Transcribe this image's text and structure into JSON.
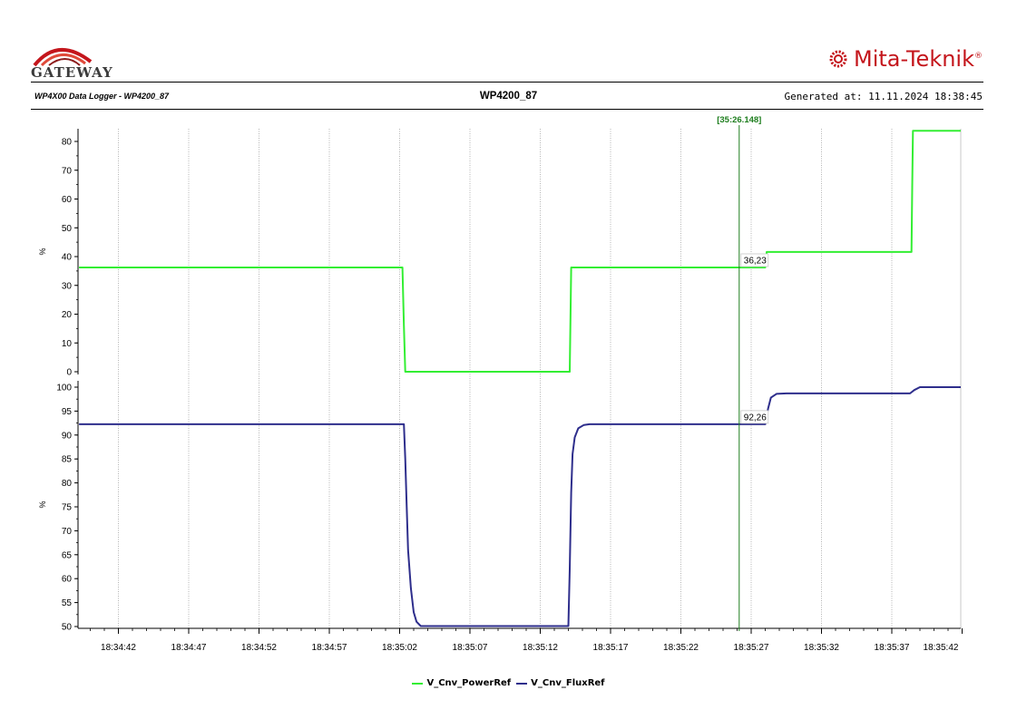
{
  "header": {
    "left_logo": "GATEWAY",
    "right_logo": "Mita-Teknik",
    "right_logo_mark": "®",
    "subtitle_left": "WP4X00 Data Logger - WP4200_87",
    "title": "WP4200_87",
    "generated": "Generated at:  11.11.2024 18:38:45"
  },
  "colors": {
    "power": "#33ee33",
    "flux": "#2e2e8c",
    "cursor": "#1e7e1e",
    "grid": "#a0a0a0"
  },
  "chart_data": {
    "type": "line",
    "cursor": {
      "label": "[35:26.148]",
      "time": "18:35:26.148"
    },
    "x_axis": {
      "ticks": [
        "18:34:42",
        "18:34:47",
        "18:34:52",
        "18:34:57",
        "18:35:02",
        "18:35:07",
        "18:35:12",
        "18:35:17",
        "18:35:22",
        "18:35:27",
        "18:35:32",
        "18:35:37",
        "18:35:42"
      ]
    },
    "panels": [
      {
        "ylabel": "%",
        "ylim": [
          -1,
          84
        ],
        "yticks": [
          0,
          10,
          20,
          30,
          40,
          50,
          60,
          70,
          80
        ],
        "series": [
          {
            "name": "V_Cnv_PowerRef",
            "color": "#33ee33",
            "cursor_value": "36,23",
            "points": [
              [
                -2.8,
                36.23
              ],
              [
                20.2,
                36.23
              ],
              [
                20.3,
                16.0
              ],
              [
                20.4,
                0
              ],
              [
                32.1,
                0
              ],
              [
                32.2,
                36.23
              ],
              [
                46.0,
                36.23
              ],
              [
                46.1,
                41.6
              ],
              [
                56.4,
                41.6
              ],
              [
                56.45,
                64
              ],
              [
                56.5,
                83.7
              ],
              [
                62.0,
                83.7
              ]
            ]
          }
        ]
      },
      {
        "ylabel": "%",
        "ylim": [
          49.5,
          101
        ],
        "yticks": [
          50,
          55,
          60,
          65,
          70,
          75,
          80,
          85,
          90,
          95,
          100
        ],
        "series": [
          {
            "name": "V_Cnv_FluxRef",
            "color": "#2e2e8c",
            "cursor_value": "92,26",
            "points": [
              [
                -2.8,
                92.26
              ],
              [
                20.3,
                92.26
              ],
              [
                20.4,
                85
              ],
              [
                20.5,
                75
              ],
              [
                20.6,
                66
              ],
              [
                20.8,
                58
              ],
              [
                21.0,
                53
              ],
              [
                21.2,
                51
              ],
              [
                21.5,
                50.1
              ],
              [
                32.0,
                50.1
              ],
              [
                32.1,
                62
              ],
              [
                32.2,
                78
              ],
              [
                32.3,
                86
              ],
              [
                32.45,
                89.5
              ],
              [
                32.7,
                91.4
              ],
              [
                33.1,
                92.1
              ],
              [
                33.5,
                92.26
              ],
              [
                46.0,
                92.26
              ],
              [
                46.2,
                95.5
              ],
              [
                46.4,
                97.8
              ],
              [
                46.8,
                98.6
              ],
              [
                47.5,
                98.7
              ],
              [
                56.3,
                98.7
              ],
              [
                56.6,
                99.4
              ],
              [
                57.0,
                100.0
              ],
              [
                62.0,
                100.0
              ]
            ]
          }
        ]
      }
    ],
    "legend": [
      "V_Cnv_PowerRef",
      "V_Cnv_FluxRef"
    ]
  }
}
